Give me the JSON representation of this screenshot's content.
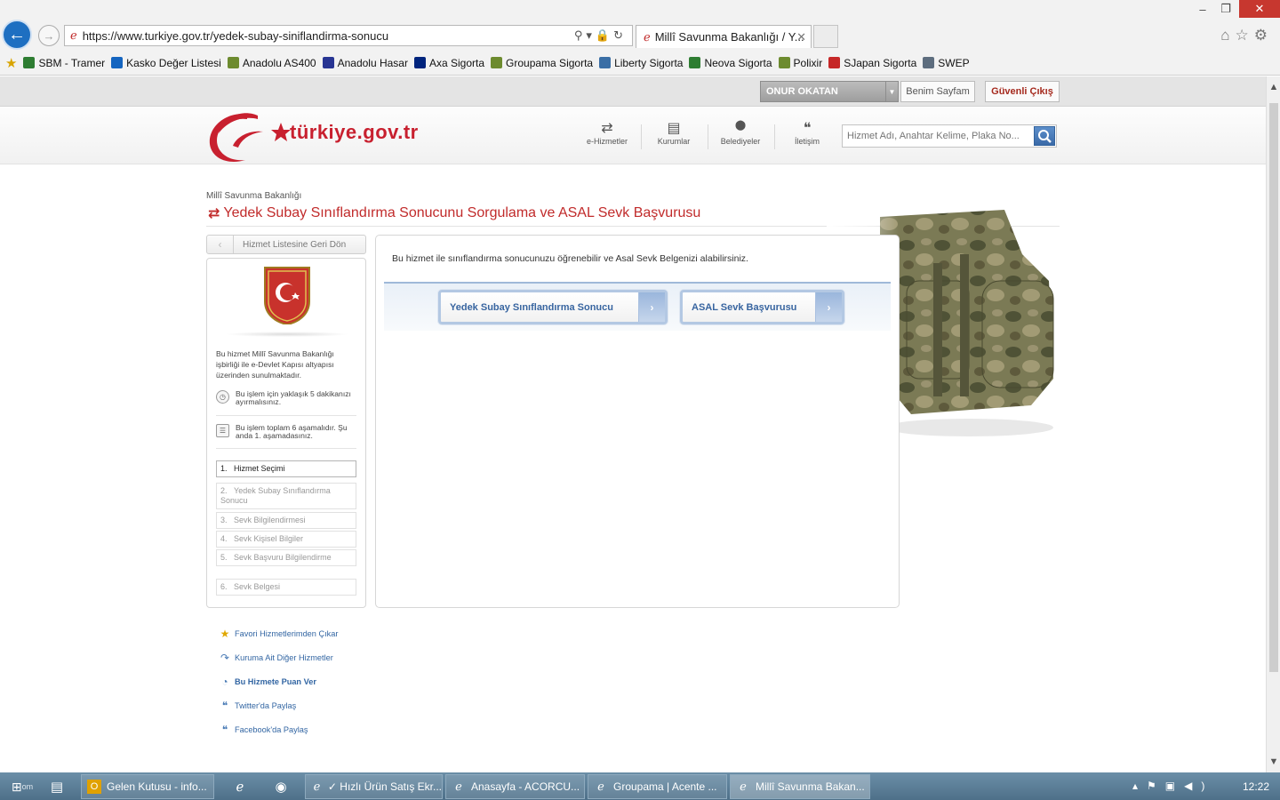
{
  "browser": {
    "url": "https://www.turkiye.gov.tr/yedek-subay-siniflandirma-sonucu",
    "tab_title": "Millî Savunma Bakanlığı / Y...",
    "favorites": [
      {
        "label": "SBM - Tramer",
        "color": "#2e7d32"
      },
      {
        "label": "Kasko Değer Listesi",
        "color": "#1565c0"
      },
      {
        "label": "Anadolu AS400",
        "color": "#6d8b2f"
      },
      {
        "label": "Anadolu Hasar",
        "color": "#283593"
      },
      {
        "label": "Axa Sigorta",
        "color": "#00247d"
      },
      {
        "label": "Groupama Sigorta",
        "color": "#6d8b2f"
      },
      {
        "label": "Liberty Sigorta",
        "color": "#3a6ea5"
      },
      {
        "label": "Neova Sigorta",
        "color": "#2e7d32"
      },
      {
        "label": "Polixir",
        "color": "#6d8b2f"
      },
      {
        "label": "SJapan Sigorta",
        "color": "#c62828"
      },
      {
        "label": "SWEP",
        "color": "#5d6d7e"
      }
    ]
  },
  "userbar": {
    "user_name": "ONUR OKATAN",
    "my_page": "Benim Sayfam",
    "logout": "Güvenli Çıkış"
  },
  "header": {
    "logo_text": "türkiye.gov.tr",
    "nav": [
      {
        "label": "e-Hizmetler",
        "icon": "refresh-arrows-icon",
        "glyph": "⇄"
      },
      {
        "label": "Kurumlar",
        "icon": "building-icon",
        "glyph": "▤"
      },
      {
        "label": "Belediyeler",
        "icon": "map-pin-icon",
        "glyph": "⬤"
      },
      {
        "label": "İletişim",
        "icon": "chat-bubbles-icon",
        "glyph": "❝"
      }
    ],
    "search_placeholder": "Hizmet Adı, Anahtar Kelime, Plaka No..."
  },
  "content": {
    "breadcrumb": "Millî Savunma Bakanlığı",
    "title": "Yedek Subay Sınıflandırma Sonucunu Sorgulama ve ASAL Sevk Başvurusu",
    "back_to_list": "Hizmet Listesine Geri Dön",
    "intro": "Bu hizmet Millî Savunma Bakanlığı işbirliği ile e-Devlet Kapısı altyapısı üzerinden sunulmaktadır.",
    "time_info": "Bu işlem için yaklaşık 5 dakikanızı ayırmalısınız.",
    "steps_info": "Bu işlem toplam 6 aşamalıdır. Şu anda 1. aşamadasınız.",
    "steps": [
      {
        "num": "1.",
        "label": "Hizmet Seçimi"
      },
      {
        "num": "2.",
        "label": "Yedek Subay Sınıflandırma Sonucu"
      },
      {
        "num": "3.",
        "label": "Sevk Bilgilendirmesi"
      },
      {
        "num": "4.",
        "label": "Sevk Kişisel Bilgiler"
      },
      {
        "num": "5.",
        "label": "Sevk Başvuru Bilgilendirme"
      },
      {
        "num": "6.",
        "label": "Sevk Belgesi"
      }
    ],
    "side_links": [
      {
        "label": "Favori Hizmetlerimden Çıkar",
        "icon": "star-icon"
      },
      {
        "label": "Kuruma Ait Diğer Hizmetler",
        "icon": "arrow-curve-icon"
      },
      {
        "label": "Bu Hizmete Puan Ver",
        "icon": "rating-icon"
      },
      {
        "label": "Twitter'da Paylaş",
        "icon": "twitter-icon"
      },
      {
        "label": "Facebook'da Paylaş",
        "icon": "facebook-icon"
      }
    ],
    "description": "Bu hizmet ile sınıflandırma sonucunuzu öğrenebilir ve Asal Sevk Belgenizi alabilirsiniz.",
    "choice_1": "Yedek Subay Sınıflandırma Sonucu",
    "choice_2": "ASAL Sevk Başvurusu"
  },
  "taskbar": {
    "start_label": "om",
    "items": [
      {
        "label": "Gelen Kutusu - info...",
        "icon": "outlook-icon"
      },
      {
        "label": "✓ Hızlı Ürün Satış Ekr...",
        "icon": "ie-icon"
      },
      {
        "label": "Anasayfa - ACORCU...",
        "icon": "ie-icon"
      },
      {
        "label": "Groupama | Acente ...",
        "icon": "ie-icon"
      },
      {
        "label": "Millî Savunma Bakan...",
        "icon": "ie-icon"
      }
    ],
    "time": "12:22"
  },
  "colors": {
    "brand_red": "#c12b2b",
    "link_blue": "#3366a3",
    "taskbar": "#5a7c94"
  }
}
